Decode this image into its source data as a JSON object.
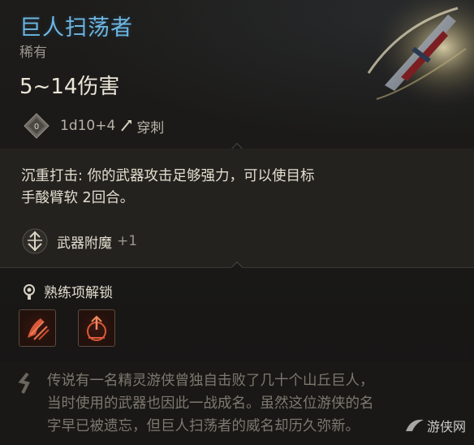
{
  "item": {
    "name": "巨人扫荡者",
    "rarity": "稀有",
    "damage_text": "5~14伤害",
    "damage_dice": "1d10+4",
    "damage_type": "穿刺"
  },
  "passive": {
    "text_line1": "沉重打击: 你的武器攻击足够强力，可以使目标",
    "text_line2": "手酸臂软 2回合。"
  },
  "enchantment": {
    "label": "武器附魔",
    "value": "+1"
  },
  "proficiency": {
    "header": "熟练项解锁",
    "abilities": [
      {
        "icon": "beast-slash-icon"
      },
      {
        "icon": "crippling-strike-icon"
      }
    ]
  },
  "lore": {
    "line1": "传说有一名精灵游侠曾独自击败了几十个山丘巨人，",
    "line2": "当时使用的武器也因此一战成名。虽然这位游侠的名",
    "line3": "字早已被遗忘，但巨人扫荡者的威名却历久弥新。"
  },
  "watermark": {
    "text": "游侠网"
  },
  "colors": {
    "title": "#6db6e3",
    "rarity": "#9a958c",
    "text": "#e3ddcf",
    "lore": "#7d786f",
    "ability_red": "#d9593a"
  }
}
